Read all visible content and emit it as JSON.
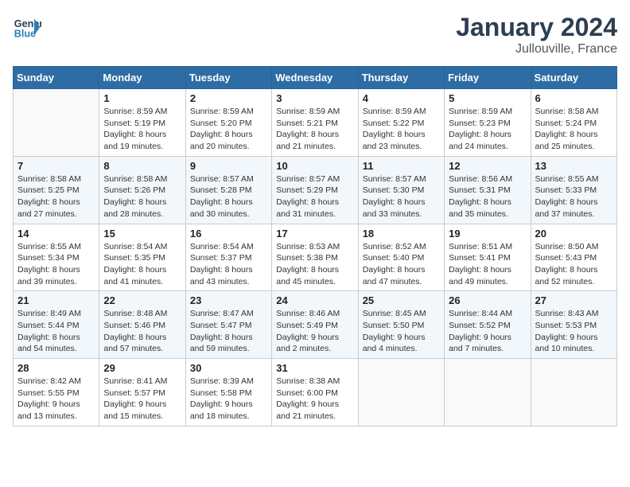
{
  "header": {
    "logo_line1": "General",
    "logo_line2": "Blue",
    "month": "January 2024",
    "location": "Jullouville, France"
  },
  "weekdays": [
    "Sunday",
    "Monday",
    "Tuesday",
    "Wednesday",
    "Thursday",
    "Friday",
    "Saturday"
  ],
  "weeks": [
    [
      {
        "day": "",
        "info": ""
      },
      {
        "day": "1",
        "info": "Sunrise: 8:59 AM\nSunset: 5:19 PM\nDaylight: 8 hours\nand 19 minutes."
      },
      {
        "day": "2",
        "info": "Sunrise: 8:59 AM\nSunset: 5:20 PM\nDaylight: 8 hours\nand 20 minutes."
      },
      {
        "day": "3",
        "info": "Sunrise: 8:59 AM\nSunset: 5:21 PM\nDaylight: 8 hours\nand 21 minutes."
      },
      {
        "day": "4",
        "info": "Sunrise: 8:59 AM\nSunset: 5:22 PM\nDaylight: 8 hours\nand 23 minutes."
      },
      {
        "day": "5",
        "info": "Sunrise: 8:59 AM\nSunset: 5:23 PM\nDaylight: 8 hours\nand 24 minutes."
      },
      {
        "day": "6",
        "info": "Sunrise: 8:58 AM\nSunset: 5:24 PM\nDaylight: 8 hours\nand 25 minutes."
      }
    ],
    [
      {
        "day": "7",
        "info": "Sunrise: 8:58 AM\nSunset: 5:25 PM\nDaylight: 8 hours\nand 27 minutes."
      },
      {
        "day": "8",
        "info": "Sunrise: 8:58 AM\nSunset: 5:26 PM\nDaylight: 8 hours\nand 28 minutes."
      },
      {
        "day": "9",
        "info": "Sunrise: 8:57 AM\nSunset: 5:28 PM\nDaylight: 8 hours\nand 30 minutes."
      },
      {
        "day": "10",
        "info": "Sunrise: 8:57 AM\nSunset: 5:29 PM\nDaylight: 8 hours\nand 31 minutes."
      },
      {
        "day": "11",
        "info": "Sunrise: 8:57 AM\nSunset: 5:30 PM\nDaylight: 8 hours\nand 33 minutes."
      },
      {
        "day": "12",
        "info": "Sunrise: 8:56 AM\nSunset: 5:31 PM\nDaylight: 8 hours\nand 35 minutes."
      },
      {
        "day": "13",
        "info": "Sunrise: 8:55 AM\nSunset: 5:33 PM\nDaylight: 8 hours\nand 37 minutes."
      }
    ],
    [
      {
        "day": "14",
        "info": "Sunrise: 8:55 AM\nSunset: 5:34 PM\nDaylight: 8 hours\nand 39 minutes."
      },
      {
        "day": "15",
        "info": "Sunrise: 8:54 AM\nSunset: 5:35 PM\nDaylight: 8 hours\nand 41 minutes."
      },
      {
        "day": "16",
        "info": "Sunrise: 8:54 AM\nSunset: 5:37 PM\nDaylight: 8 hours\nand 43 minutes."
      },
      {
        "day": "17",
        "info": "Sunrise: 8:53 AM\nSunset: 5:38 PM\nDaylight: 8 hours\nand 45 minutes."
      },
      {
        "day": "18",
        "info": "Sunrise: 8:52 AM\nSunset: 5:40 PM\nDaylight: 8 hours\nand 47 minutes."
      },
      {
        "day": "19",
        "info": "Sunrise: 8:51 AM\nSunset: 5:41 PM\nDaylight: 8 hours\nand 49 minutes."
      },
      {
        "day": "20",
        "info": "Sunrise: 8:50 AM\nSunset: 5:43 PM\nDaylight: 8 hours\nand 52 minutes."
      }
    ],
    [
      {
        "day": "21",
        "info": "Sunrise: 8:49 AM\nSunset: 5:44 PM\nDaylight: 8 hours\nand 54 minutes."
      },
      {
        "day": "22",
        "info": "Sunrise: 8:48 AM\nSunset: 5:46 PM\nDaylight: 8 hours\nand 57 minutes."
      },
      {
        "day": "23",
        "info": "Sunrise: 8:47 AM\nSunset: 5:47 PM\nDaylight: 8 hours\nand 59 minutes."
      },
      {
        "day": "24",
        "info": "Sunrise: 8:46 AM\nSunset: 5:49 PM\nDaylight: 9 hours\nand 2 minutes."
      },
      {
        "day": "25",
        "info": "Sunrise: 8:45 AM\nSunset: 5:50 PM\nDaylight: 9 hours\nand 4 minutes."
      },
      {
        "day": "26",
        "info": "Sunrise: 8:44 AM\nSunset: 5:52 PM\nDaylight: 9 hours\nand 7 minutes."
      },
      {
        "day": "27",
        "info": "Sunrise: 8:43 AM\nSunset: 5:53 PM\nDaylight: 9 hours\nand 10 minutes."
      }
    ],
    [
      {
        "day": "28",
        "info": "Sunrise: 8:42 AM\nSunset: 5:55 PM\nDaylight: 9 hours\nand 13 minutes."
      },
      {
        "day": "29",
        "info": "Sunrise: 8:41 AM\nSunset: 5:57 PM\nDaylight: 9 hours\nand 15 minutes."
      },
      {
        "day": "30",
        "info": "Sunrise: 8:39 AM\nSunset: 5:58 PM\nDaylight: 9 hours\nand 18 minutes."
      },
      {
        "day": "31",
        "info": "Sunrise: 8:38 AM\nSunset: 6:00 PM\nDaylight: 9 hours\nand 21 minutes."
      },
      {
        "day": "",
        "info": ""
      },
      {
        "day": "",
        "info": ""
      },
      {
        "day": "",
        "info": ""
      }
    ]
  ]
}
